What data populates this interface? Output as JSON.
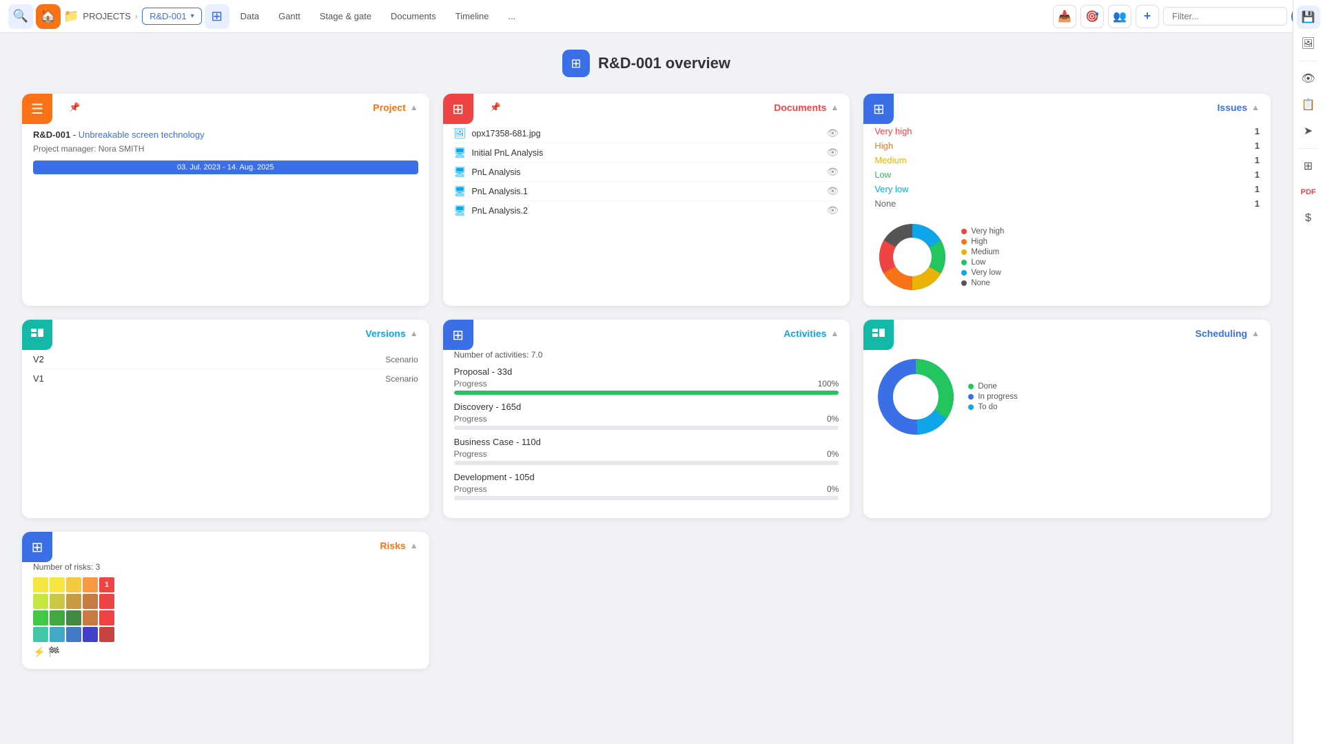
{
  "nav": {
    "search_icon": "🔍",
    "home_icon": "🏠",
    "projects_label": "PROJECTS",
    "separator": "›",
    "current_project": "R&D-001",
    "grid_icon": "⊞",
    "tabs": [
      "Data",
      "Gantt",
      "Stage & gate",
      "Documents",
      "Timeline",
      "..."
    ],
    "icons": [
      "📥",
      "🎯",
      "👥",
      "+"
    ],
    "filter_placeholder": "Filter...",
    "user_icon": "👤"
  },
  "right_sidebar": {
    "icons": [
      "💾",
      "🖼",
      "👁",
      "📋",
      "➤",
      "🔲",
      "📄",
      "$"
    ]
  },
  "page": {
    "title": "R&D-001 overview",
    "title_icon": "⊞"
  },
  "project_card": {
    "header_title": "Project",
    "icon": "☰",
    "pin_icon": "📌",
    "project_id": "R&D-001",
    "project_name": "Unbreakable screen technology",
    "manager_label": "Project manager:",
    "manager_name": "Nora SMITH",
    "dates": "03. Jul. 2023 - 14. Aug. 2025"
  },
  "documents_card": {
    "header_title": "Documents",
    "pin_icon": "📌",
    "documents": [
      {
        "name": "opx17358-681.jpg",
        "type": "image"
      },
      {
        "name": "Initial PnL Analysis",
        "type": "screen"
      },
      {
        "name": "PnL Analysis",
        "type": "screen"
      },
      {
        "name": "PnL Analysis.1",
        "type": "screen"
      },
      {
        "name": "PnL Analysis.2",
        "type": "screen"
      }
    ]
  },
  "issues_card": {
    "header_title": "Issues",
    "items": [
      {
        "label": "Very high",
        "count": "1",
        "class": "very-high"
      },
      {
        "label": "High",
        "count": "1",
        "class": "high"
      },
      {
        "label": "Medium",
        "count": "1",
        "class": "medium"
      },
      {
        "label": "Low",
        "count": "1",
        "class": "low"
      },
      {
        "label": "Very low",
        "count": "1",
        "class": "very-low"
      },
      {
        "label": "None",
        "count": "1",
        "class": "none"
      }
    ],
    "chart": {
      "segments": [
        {
          "label": "Very high",
          "color": "#ef4444",
          "value": 16.7
        },
        {
          "label": "High",
          "color": "#f97316",
          "value": 16.7
        },
        {
          "label": "Medium",
          "color": "#eab308",
          "value": 16.7
        },
        {
          "label": "Low",
          "color": "#22c55e",
          "value": 16.7
        },
        {
          "label": "Very low",
          "color": "#0ea5e9",
          "value": 16.7
        },
        {
          "label": "None",
          "color": "#555555",
          "value": 16.7
        }
      ]
    }
  },
  "versions_card": {
    "header_title": "Versions",
    "versions": [
      {
        "name": "V2",
        "type": "Scenario"
      },
      {
        "name": "V1",
        "type": "Scenario"
      }
    ]
  },
  "activities_card": {
    "header_title": "Activities",
    "activities_count": "Number of activities: 7.0",
    "activities": [
      {
        "name": "Proposal - 33d",
        "progress_label": "Progress",
        "progress_pct": "100%",
        "fill_width": 100
      },
      {
        "name": "Discovery - 165d",
        "progress_label": "Progress",
        "progress_pct": "0%",
        "fill_width": 0
      },
      {
        "name": "Business Case - 110d",
        "progress_label": "Progress",
        "progress_pct": "0%",
        "fill_width": 0
      },
      {
        "name": "Development - 105d",
        "progress_label": "Progress",
        "progress_pct": "0%",
        "fill_width": 0
      }
    ]
  },
  "risks_card": {
    "header_title": "Risks",
    "risks_count": "Number of risks: 3",
    "heatmap_colors": [
      "#f5e642",
      "#f5e642",
      "#f5c842",
      "#f59a42",
      "#ef4444",
      "#c8e642",
      "#c8c842",
      "#c89a42",
      "#c87a42",
      "#ef4444",
      "#42c842",
      "#42a842",
      "#428a42",
      "#c87a42",
      "#ef4444",
      "#42c8a8",
      "#42a8c8",
      "#427ac8",
      "#4242c8",
      "#c84242",
      "#42e8c8",
      "#42c8e8",
      "#4298e8",
      "#4268e8",
      "#a842e8"
    ]
  },
  "scheduling_card": {
    "header_title": "Scheduling",
    "legend": [
      {
        "label": "Done",
        "color": "#22c55e"
      },
      {
        "label": "In progress",
        "color": "#3b6fe8"
      },
      {
        "label": "To do",
        "color": "#0ea5e9"
      }
    ]
  },
  "colors": {
    "orange": "#f97316",
    "teal": "#0ea5e9",
    "red": "#ef4444",
    "blue": "#3b6fe8",
    "green": "#22c55e",
    "gray": "#555555"
  }
}
